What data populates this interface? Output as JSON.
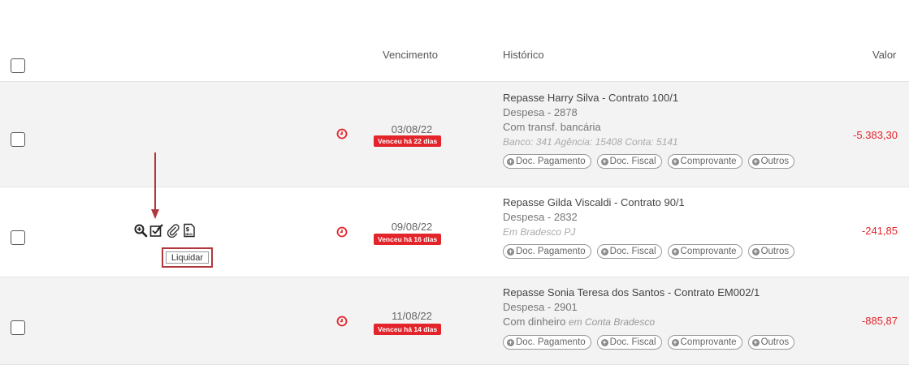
{
  "header": {
    "col_vencimento": "Vencimento",
    "col_historico": "Histórico",
    "col_valor": "Valor"
  },
  "rows": [
    {
      "date": "03/08/22",
      "badge": "Venceu há 22 dias",
      "title": "Repasse Harry Silva - Contrato 100/1",
      "category": "Despesa - 2878",
      "method": "Com transf. bancária",
      "bank_info": "Banco: 341 Agência: 15408 Conta: 5141",
      "valor": "-5.383,30"
    },
    {
      "date": "09/08/22",
      "badge": "Venceu há 16 dias",
      "title": "Repasse Gilda Viscaldi - Contrato 90/1",
      "category": "Despesa - 2832",
      "bank_info": "Em Bradesco PJ",
      "valor": "-241,85"
    },
    {
      "date": "11/08/22",
      "badge": "Venceu há 14 dias",
      "title": "Repasse Sonia Teresa dos Santos - Contrato EM002/1",
      "category": "Despesa - 2901",
      "method": "Com dinheiro",
      "method_em": "em Conta Bradesco",
      "valor": "-885,87"
    }
  ],
  "chips": {
    "doc_pagamento": "Doc. Pagamento",
    "doc_fiscal": "Doc. Fiscal",
    "comprovante": "Comprovante",
    "outros": "Outros"
  },
  "tooltip": {
    "label": "Liquidar"
  },
  "colors": {
    "accent_red": "#e3242b",
    "tooltip_border": "#b0383c",
    "arrow": "#b0383c"
  },
  "icons": [
    "zoom-icon",
    "liquidar-icon",
    "attach-icon",
    "boleto-icon",
    "clock-icon",
    "plus-icon"
  ]
}
